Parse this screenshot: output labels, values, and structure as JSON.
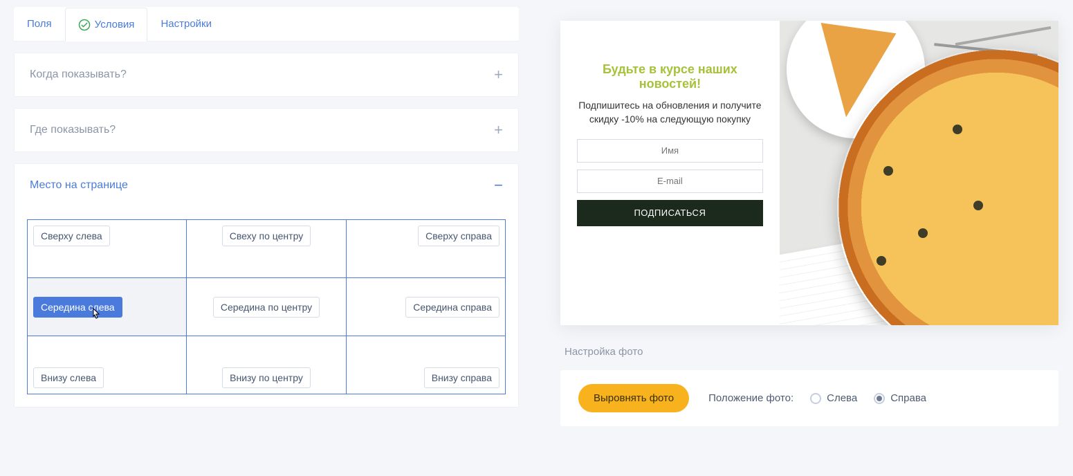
{
  "tabs": {
    "fields": "Поля",
    "conditions": "Условия",
    "settings": "Настройки"
  },
  "accordions": {
    "when": "Когда показывать?",
    "where": "Где показывать?",
    "place": "Место на странице"
  },
  "positions": {
    "tl": "Сверху слева",
    "tc": "Свеху по центру",
    "tr": "Сверху справа",
    "ml": "Середина слева",
    "mc": "Середина по центру",
    "mr": "Середина справа",
    "bl": "Внизу слева",
    "bc": "Внизу по центру",
    "br": "Внизу справа"
  },
  "preview": {
    "title": "Будьте в курсе наших новостей!",
    "subtitle": "Подпишитесь на обновления и получите скидку -10% на следующую покупку",
    "name_placeholder": "Имя",
    "email_placeholder": "E-mail",
    "button": "ПОДПИСАТЬСЯ"
  },
  "photo": {
    "section_label": "Настройка фото",
    "align_button": "Выровнять фото",
    "position_label": "Положение фото:",
    "left": "Слева",
    "right": "Справа"
  }
}
